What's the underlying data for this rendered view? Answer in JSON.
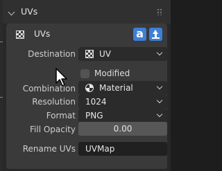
{
  "panel": {
    "title": "UVs",
    "card_title": "UVs"
  },
  "fields": {
    "destination": {
      "label": "Destination",
      "value": "UV"
    },
    "modified": {
      "label": "Modified",
      "checked": false
    },
    "combination": {
      "label": "Combination",
      "value": "Material"
    },
    "resolution": {
      "label": "Resolution",
      "value": "1024"
    },
    "format": {
      "label": "Format",
      "value": "PNG"
    },
    "fill_opacity": {
      "label": "Fill Opacity",
      "value": "0.00"
    },
    "rename_uvs": {
      "label": "Rename UVs",
      "value": "UVMap"
    }
  },
  "icons": {
    "text_button": "a"
  },
  "colors": {
    "accent": "#3f7fd6",
    "panel_bg": "#282828",
    "card_bg": "#3a3a3a"
  }
}
